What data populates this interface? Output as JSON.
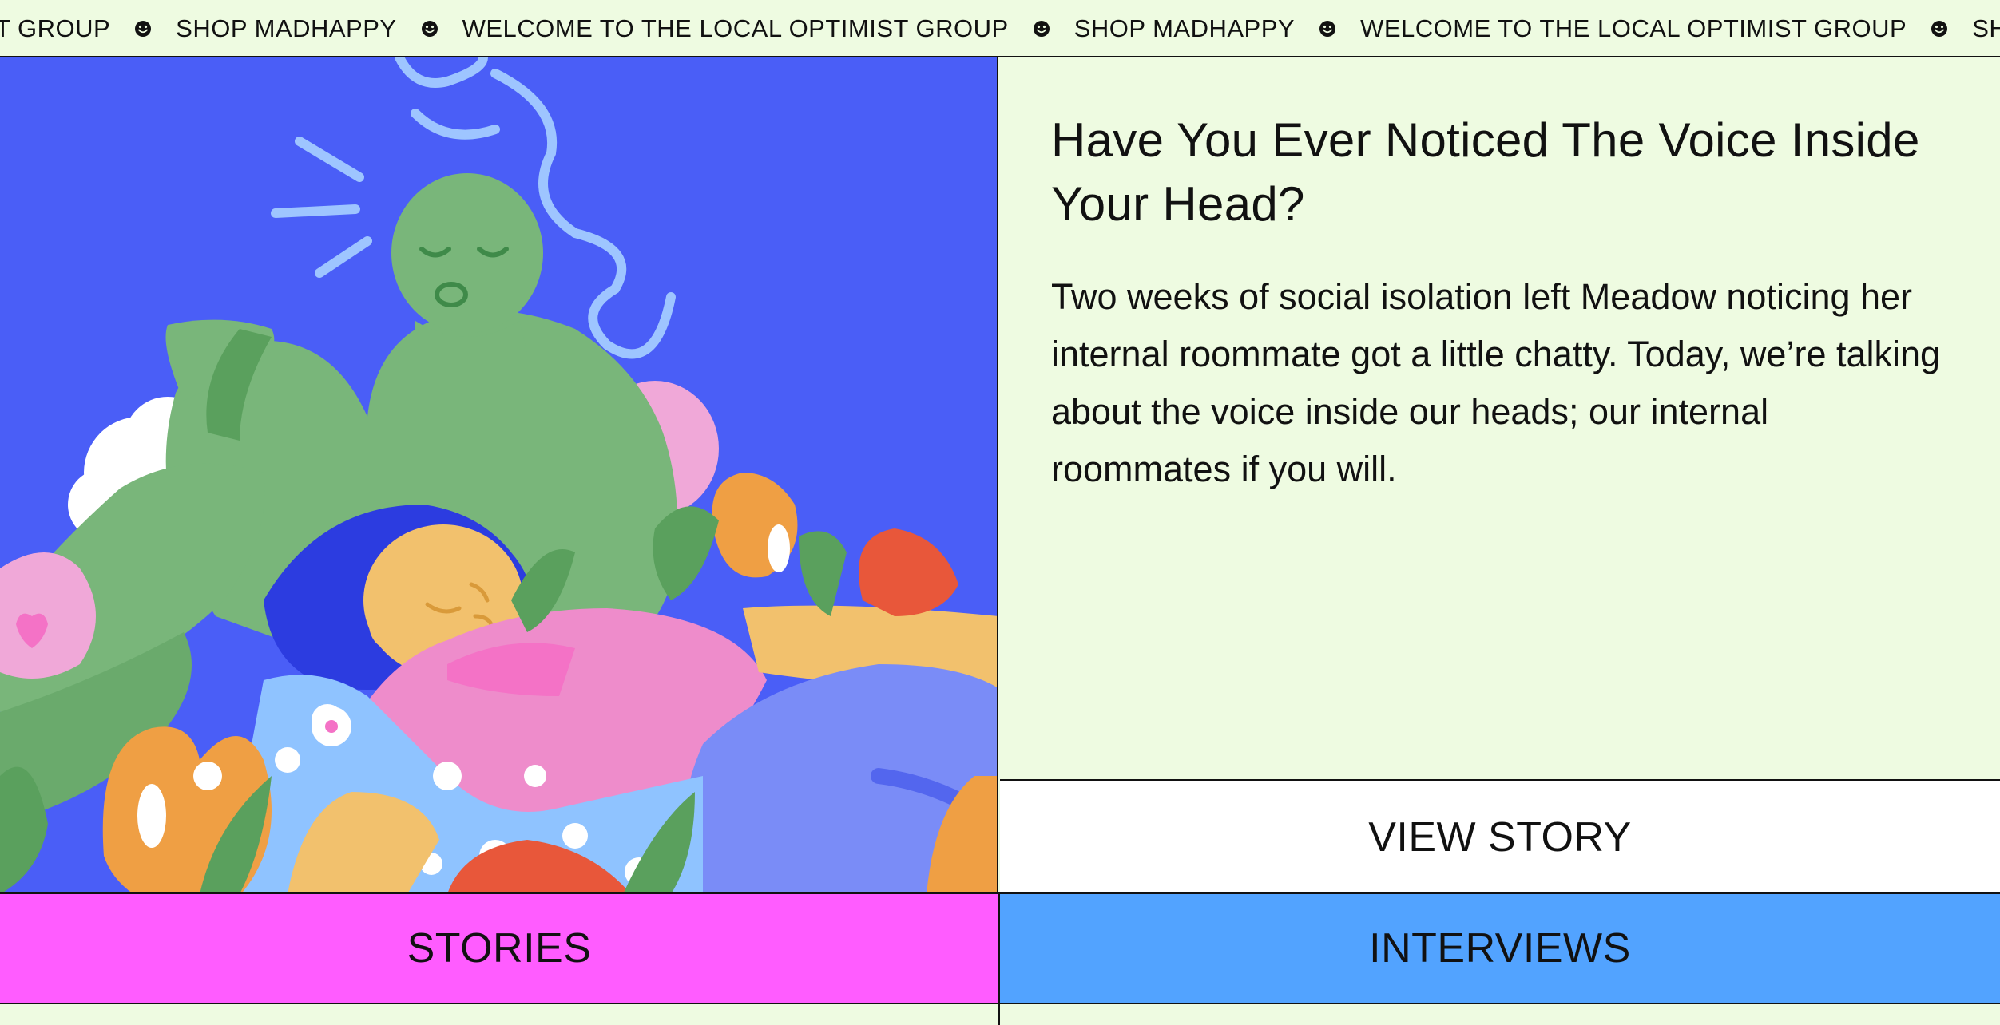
{
  "marquee": {
    "items": [
      "T GROUP",
      "SHOP MADHAPPY",
      "WELCOME TO THE LOCAL OPTIMIST GROUP",
      "SHOP MADHAPPY",
      "WELCOME TO THE LOCAL OPTIMIST GROUP",
      "SHOP MA"
    ],
    "separator_icon": "smiley-face-icon"
  },
  "article": {
    "title": "Have You Ever Noticed The Voice Inside Your Head?",
    "body": "Two weeks of social isolation left Meadow noticing her internal roommate got a little chatty. Today, we’re talking about the voice inside our heads; our internal roommates if you will.",
    "cta_label": "VIEW STORY"
  },
  "categories": {
    "stories_label": "STORIES",
    "interviews_label": "INTERVIEWS"
  },
  "colors": {
    "background": "#eefbe1",
    "stories": "#ff5cff",
    "interviews": "#52a3ff",
    "hero_background": "#4a5ef7"
  }
}
